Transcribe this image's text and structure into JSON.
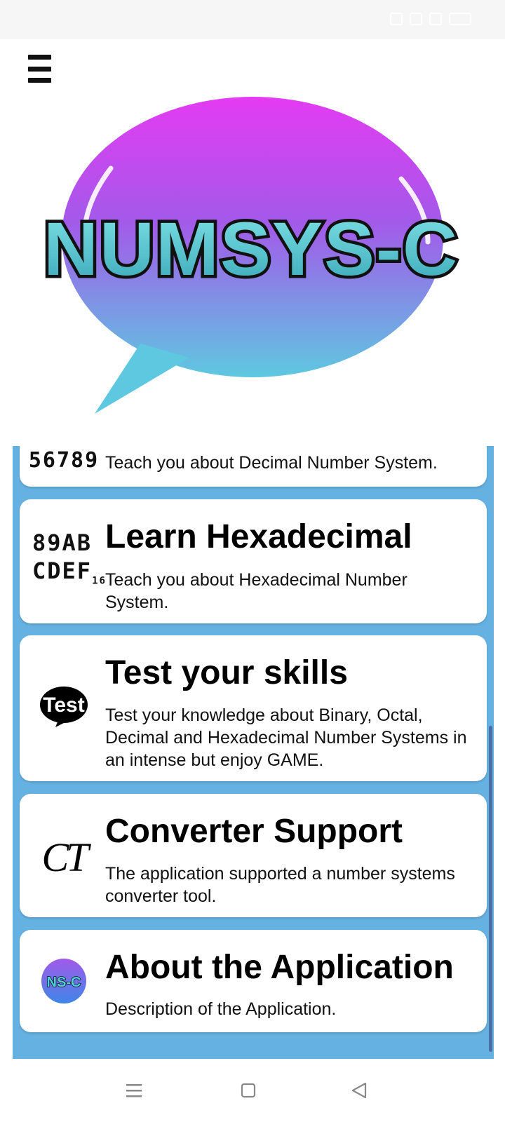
{
  "logo": {
    "text": "NUMSYS-C"
  },
  "cards": [
    {
      "icon_text": "56789",
      "title": "",
      "description": "Teach you about Decimal Number System."
    },
    {
      "icon_line1": "89AB",
      "icon_line2": "CDEF",
      "icon_sub": "16",
      "title": "Learn Hexadecimal",
      "description": "Teach you about Hexadecimal Number System."
    },
    {
      "icon_text": "Test",
      "title": "Test your skills",
      "description": "Test your knowledge about Binary, Octal, Decimal and Hexadecimal Number Systems in an intense but enjoy GAME."
    },
    {
      "icon_text": "CT",
      "title": "Converter Support",
      "description": "The application supported a number systems converter tool."
    },
    {
      "icon_text": "NS-C",
      "title": "About the Application",
      "description": "Description of the Application."
    }
  ],
  "colors": {
    "panel": "#65b2e2",
    "card": "#ffffff",
    "logo_top": "#e43bf3",
    "logo_bottom": "#5ec8e0"
  }
}
